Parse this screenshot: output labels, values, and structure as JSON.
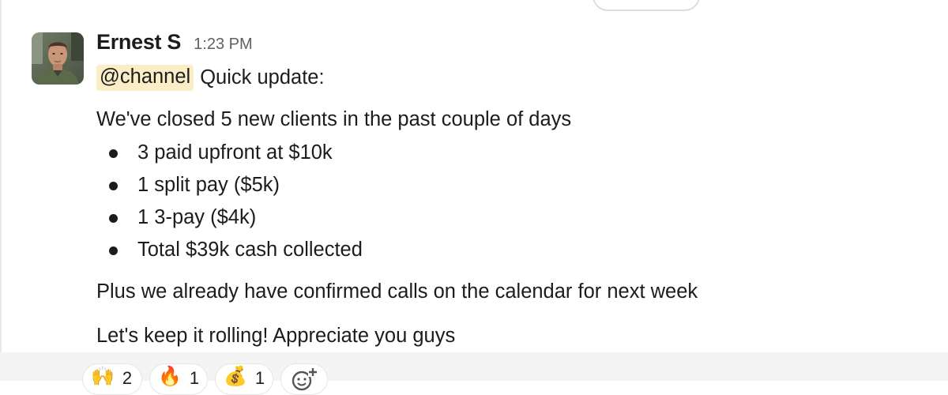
{
  "message": {
    "author": "Ernest S",
    "time": "1:23 PM",
    "mention": "@channel",
    "intro": "Quick update:",
    "paragraph1": "We've closed 5 new clients in the past couple of days",
    "bullets": [
      "3 paid upfront at $10k",
      "1 split pay ($5k)",
      "1 3-pay ($4k)",
      "Total $39k cash collected"
    ],
    "paragraph2": "Plus we already have confirmed calls on the calendar for next week",
    "paragraph3": "Let's keep it rolling! Appreciate you guys"
  },
  "reactions": [
    {
      "icon": "raised-hands-icon",
      "emoji": "🙌",
      "count": "2"
    },
    {
      "icon": "fire-icon",
      "emoji": "🔥",
      "count": "1"
    },
    {
      "icon": "money-bag-icon",
      "emoji": "💰",
      "count": "1"
    }
  ],
  "colors": {
    "mention_bg": "#fbeec6",
    "text": "#1d1c1d",
    "timestamp": "#616061"
  }
}
